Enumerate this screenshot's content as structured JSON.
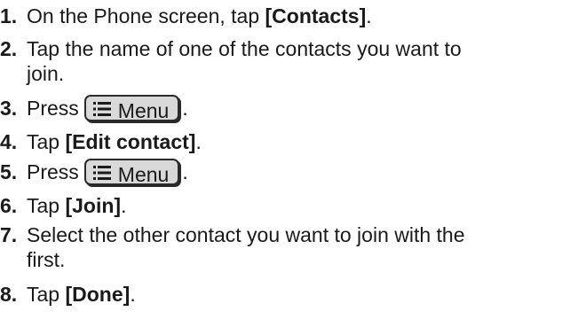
{
  "steps": [
    {
      "num": "1.",
      "pre": "On the Phone screen, tap ",
      "bold": "[Contacts]",
      "post": "."
    },
    {
      "num": "2.",
      "line1": "Tap the name of one of the contacts you want to",
      "line2": "join."
    },
    {
      "num": "3.",
      "pre": "Press",
      "key_label": "Menu",
      "post": "."
    },
    {
      "num": "4.",
      "pre": "Tap ",
      "bold": "[Edit contact]",
      "post": "."
    },
    {
      "num": "5.",
      "pre": "Press",
      "key_label": "Menu",
      "post": "."
    },
    {
      "num": "6.",
      "pre": "Tap ",
      "bold": "[Join]",
      "post": "."
    },
    {
      "num": "7.",
      "line1": "Select the other contact you want to join with the",
      "line2": "first."
    },
    {
      "num": "8.",
      "pre": "Tap ",
      "bold": "[Done]",
      "post": "."
    }
  ],
  "icons": {
    "menu_key_icon": "menu-list-icon"
  }
}
